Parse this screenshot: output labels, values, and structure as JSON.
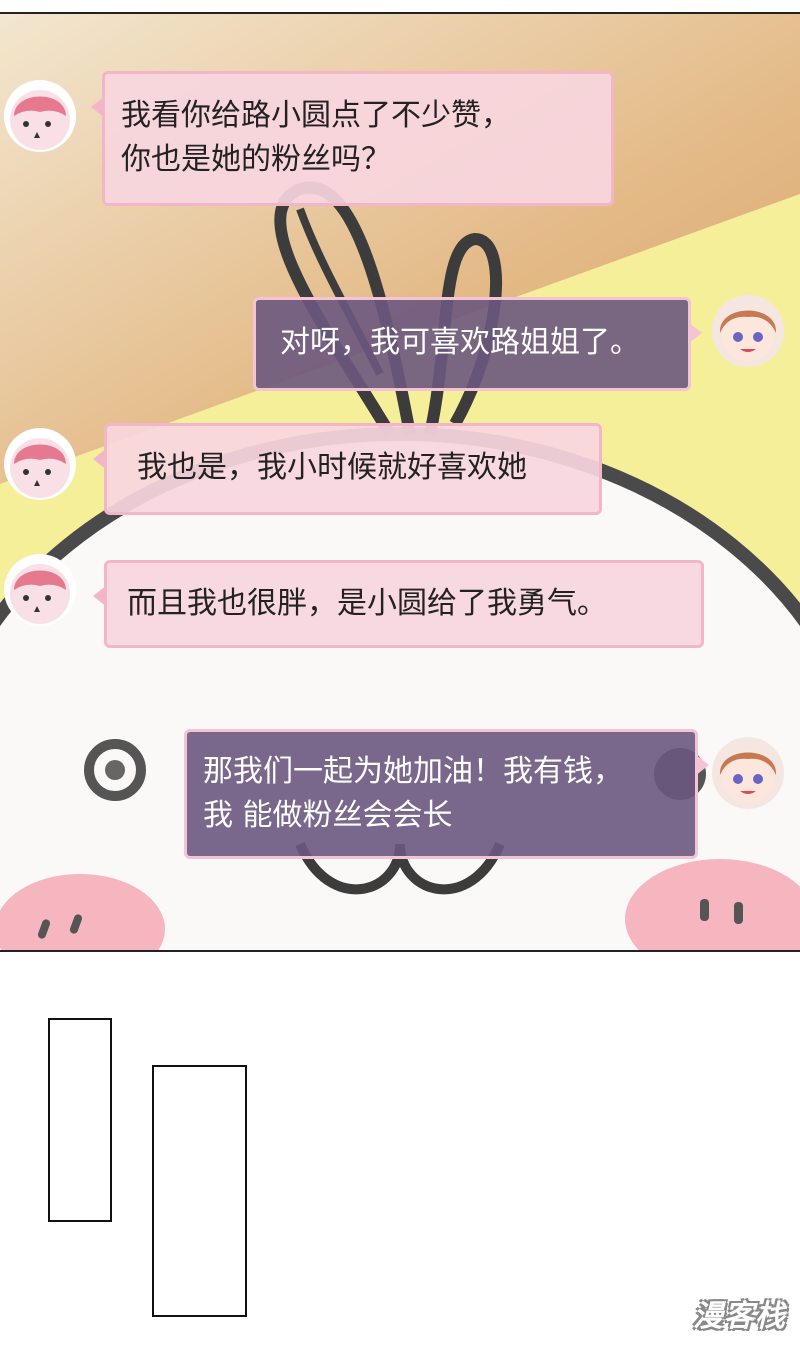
{
  "messages": [
    {
      "side": "left",
      "avatar": "pink-hair-avatar",
      "lines": [
        "我看你给路小圆点了不少赞，",
        "你也是她的粉丝吗？"
      ]
    },
    {
      "side": "right",
      "avatar": "brown-hair-girl-avatar",
      "lines": [
        "对呀，我可喜欢路姐姐了。"
      ]
    },
    {
      "side": "left",
      "avatar": "pink-hair-avatar",
      "lines": [
        "我也是，我小时候就好喜欢她"
      ]
    },
    {
      "side": "left",
      "avatar": "pink-hair-avatar",
      "lines": [
        "而且我也很胖，是小圆给了我勇气。"
      ]
    },
    {
      "side": "right",
      "avatar": "brown-hair-girl-avatar",
      "lines": [
        "那我们一起为她加油！我有钱，",
        "我 能做粉丝会会长"
      ]
    }
  ],
  "watermark": "漫客栈",
  "colors": {
    "pink_bubble": "#f7d6de",
    "purple_bubble": "#6c5880",
    "background_yellow": "#f6ef9a",
    "background_tan": "#e8c890"
  }
}
